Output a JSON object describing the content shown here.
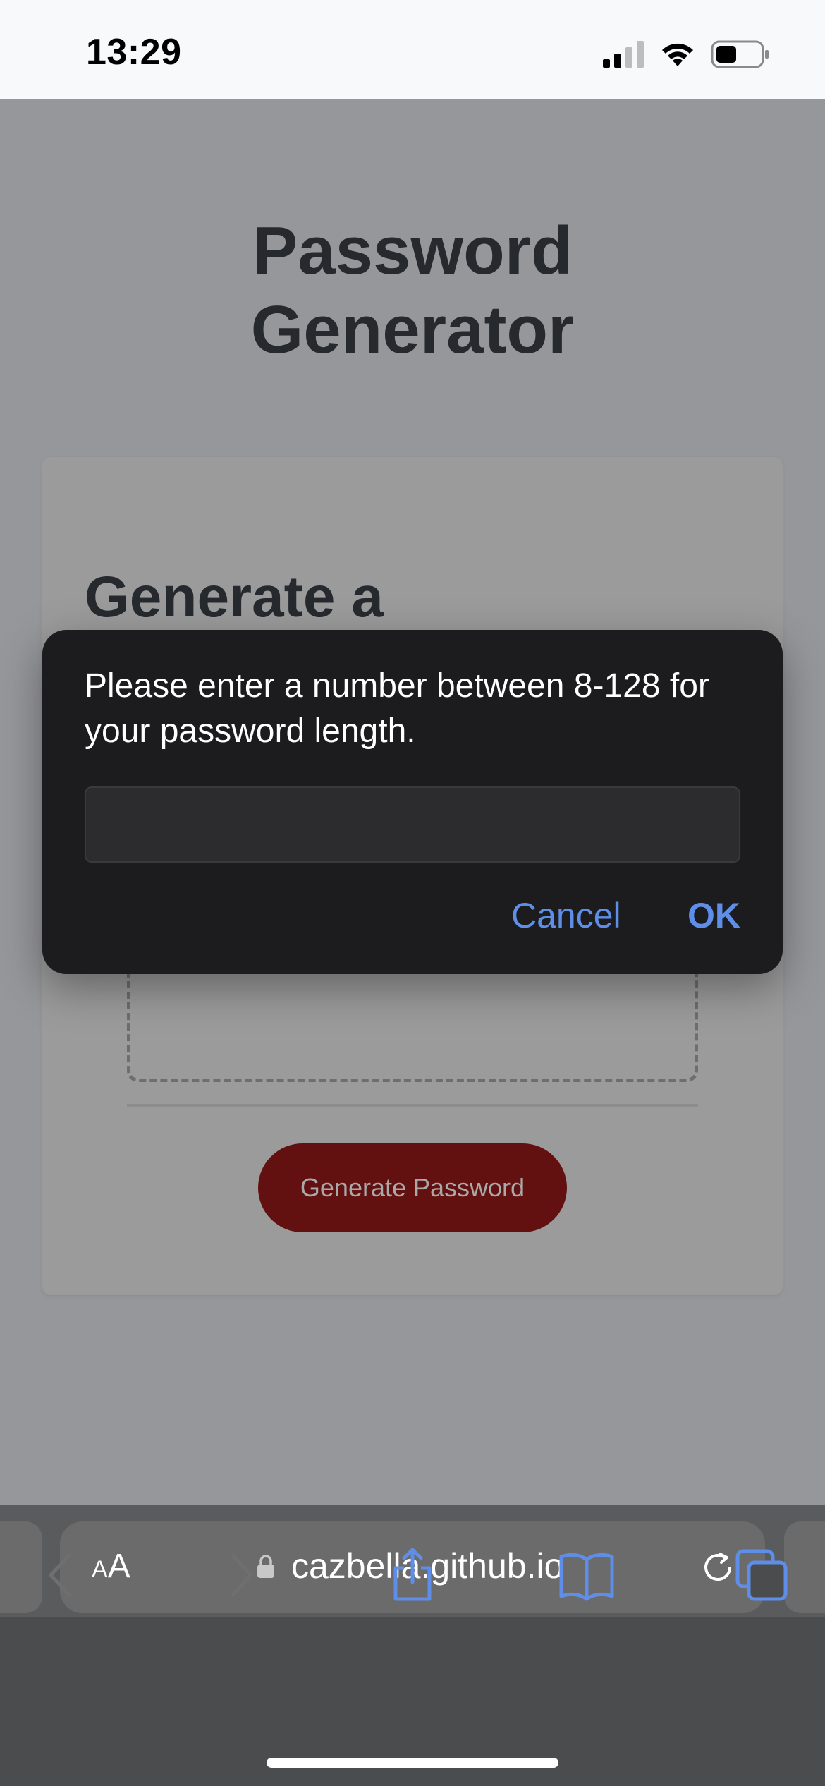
{
  "status_bar": {
    "time": "13:29"
  },
  "page": {
    "title_line1": "Password",
    "title_line2": "Generator",
    "card_heading": "Generate a",
    "generate_button": "Generate Password"
  },
  "dialog": {
    "message": "Please enter a number between 8-128 for your password length.",
    "input_value": "",
    "cancel_label": "Cancel",
    "ok_label": "OK"
  },
  "browser": {
    "aa_small": "A",
    "aa_large": "A",
    "url": "cazbella.github.io"
  },
  "icons": [
    "cellular-signal-icon",
    "wifi-icon",
    "battery-icon",
    "lock-icon",
    "reload-icon",
    "back-icon",
    "forward-icon",
    "share-icon",
    "bookmarks-icon",
    "tabs-icon"
  ],
  "colors": {
    "accent": "#5f8ee8",
    "dialog_bg": "#1c1c1e",
    "button_red": "#621010"
  }
}
